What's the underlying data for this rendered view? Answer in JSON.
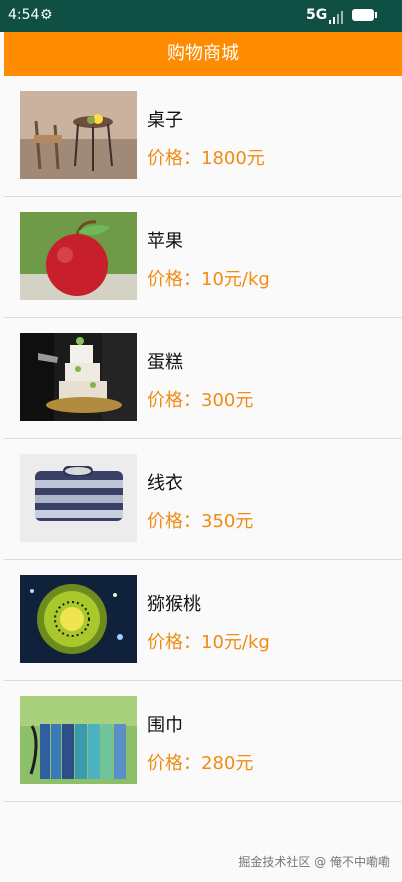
{
  "status": {
    "time": "4:54",
    "network": "5G",
    "settings_icon": "gear-icon",
    "battery_icon": "battery-icon",
    "signal_icon": "signal-icon"
  },
  "header": {
    "title": "购物商城"
  },
  "items": [
    {
      "name": "桌子",
      "price": "价格：1800元",
      "image": "table-photo"
    },
    {
      "name": "苹果",
      "price": "价格：10元/kg",
      "image": "apple-photo"
    },
    {
      "name": "蛋糕",
      "price": "价格：300元",
      "image": "cake-photo"
    },
    {
      "name": "线衣",
      "price": "价格：350元",
      "image": "sweater-photo"
    },
    {
      "name": "猕猴桃",
      "price": "价格：10元/kg",
      "image": "kiwi-photo"
    },
    {
      "name": "围巾",
      "price": "价格：280元",
      "image": "scarf-photo"
    }
  ],
  "watermark": "掘金技术社区 @ 俺不中嘞嘞"
}
